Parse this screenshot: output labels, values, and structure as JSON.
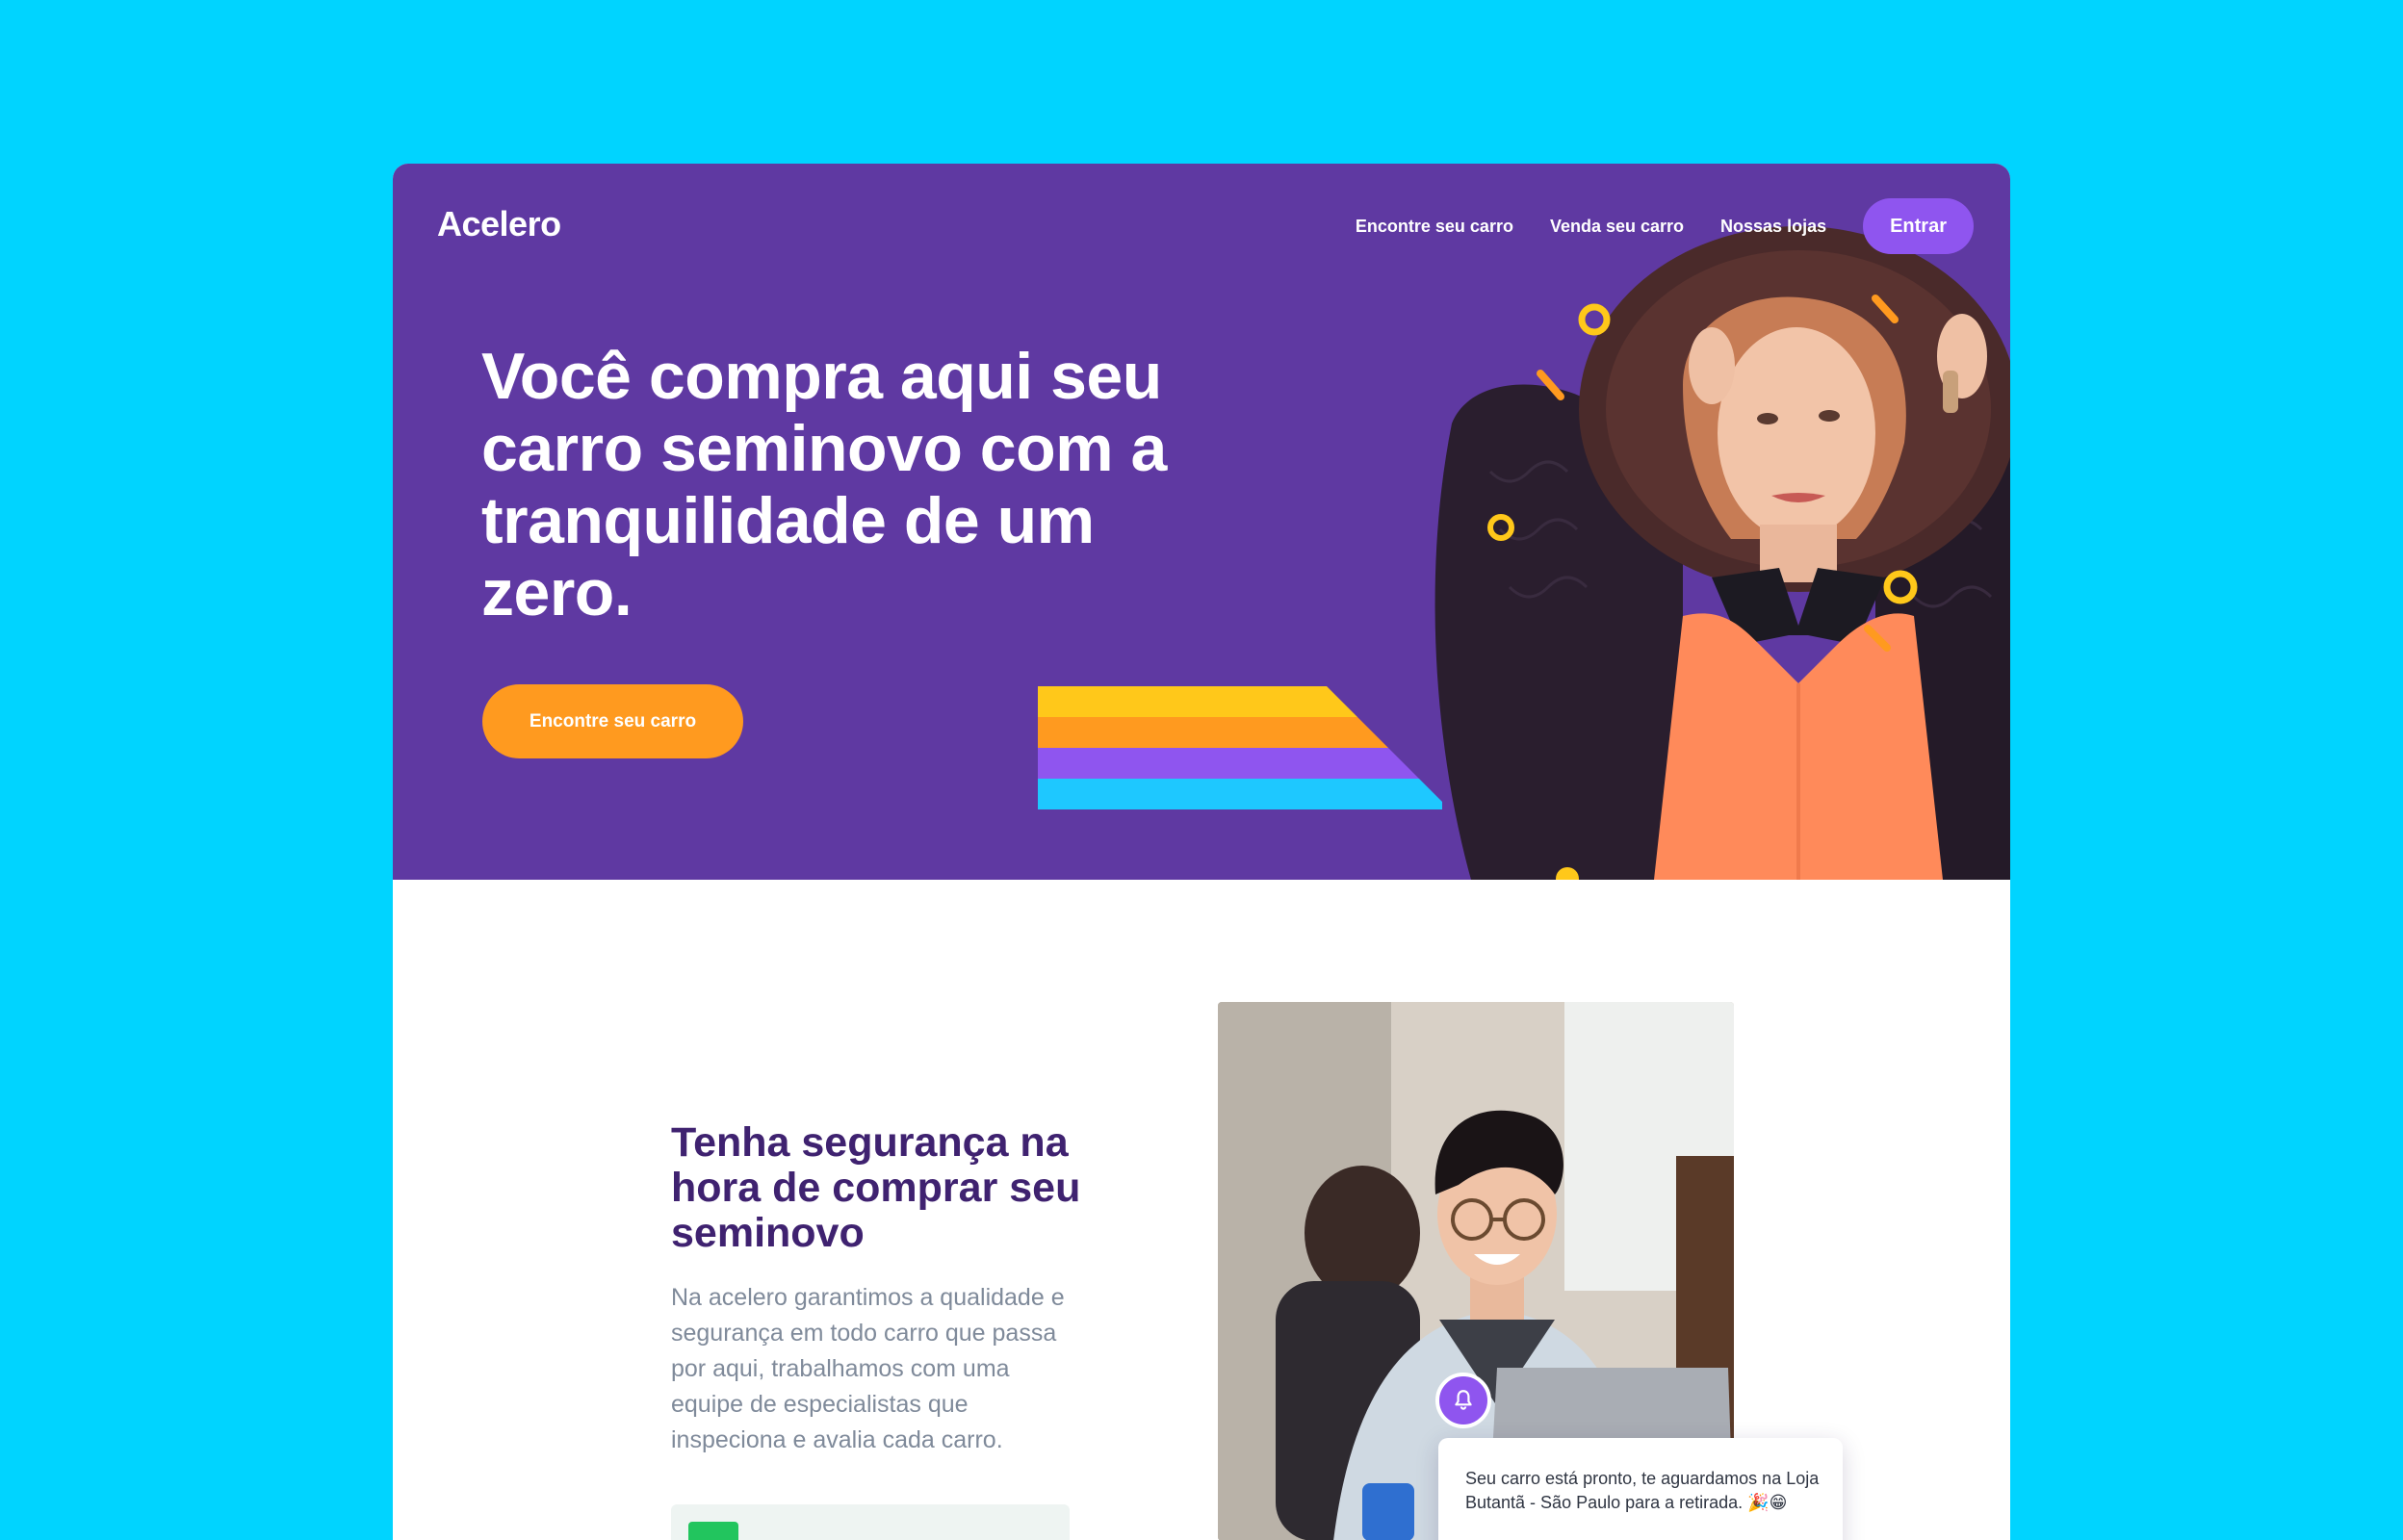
{
  "brand": {
    "name": "Acelero"
  },
  "nav": {
    "links": [
      "Encontre seu carro",
      "Venda seu carro",
      "Nossas lojas"
    ],
    "login_label": "Entrar"
  },
  "hero": {
    "title": "Você compra aqui seu carro seminovo com a tranquilidade de um zero.",
    "cta_label": "Encontre seu carro"
  },
  "feature": {
    "title": "Tenha segurança na hora de comprar seu seminovo",
    "body": "Na acelero garantimos a qualidade e segurança em todo carro que passa por aqui, trabalhamos com uma equipe de especialistas que inspeciona e avalia cada carro.",
    "notification_text": "Seu carro está pronto, te aguardamos na Loja Butantã - São Paulo para a retirada. 🎉😁"
  },
  "colors": {
    "page_background": "#00d4ff",
    "hero_background": "#5f39a2",
    "primary_button": "#8f55ef",
    "cta_button": "#ff9a1f",
    "heading": "#3f2270",
    "body_text": "#7f8a9a",
    "stripe_colors": [
      "#ffc81a",
      "#ff9a1f",
      "#8f55ef",
      "#1ec8ff"
    ]
  },
  "icons": {
    "hero_decorations": "ring-and-dash-confetti",
    "notification": "bell-icon"
  }
}
